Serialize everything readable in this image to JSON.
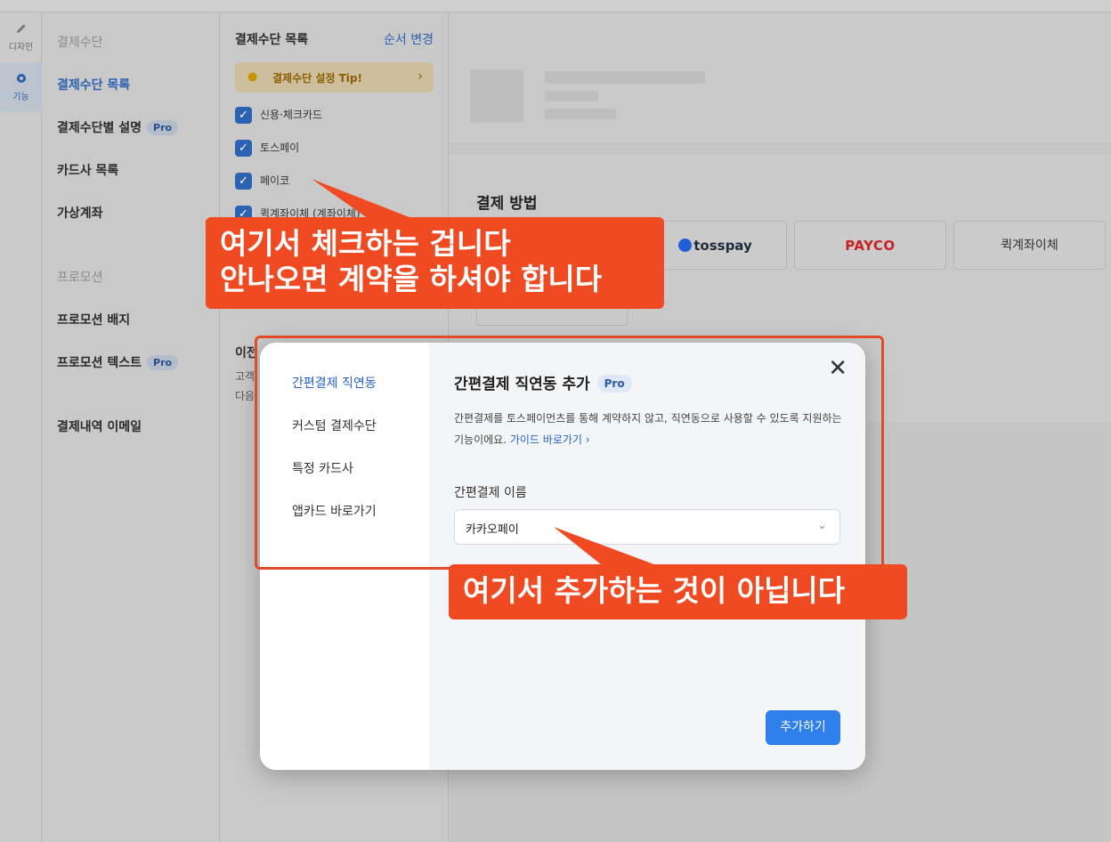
{
  "rail": [
    {
      "label": "디자인",
      "icon": "pencil-icon"
    },
    {
      "label": "기능",
      "icon": "gear-icon"
    }
  ],
  "nav": {
    "section_payment": "결제수단",
    "items_payment": [
      {
        "label": "결제수단 목록"
      },
      {
        "label": "결제수단별 설명",
        "badge": "Pro"
      },
      {
        "label": "카드사 목록"
      },
      {
        "label": "가상계좌"
      }
    ],
    "section_promo": "프로모션",
    "items_promo": [
      {
        "label": "프로모션 배지"
      },
      {
        "label": "프로모션 텍스트",
        "badge": "Pro"
      }
    ],
    "email": "결제내역 이메일"
  },
  "list": {
    "title": "결제수단 목록",
    "order_button": "순서 변경",
    "tip": "결제수단 설정 Tip!",
    "methods": [
      "신용·체크카드",
      "토스페이",
      "페이코",
      "퀵계좌이체 (계좌이체)"
    ],
    "prev_title": "이전",
    "prev_lines": [
      "고객",
      "다음"
    ]
  },
  "preview": {
    "heading": "결제 방법",
    "buttons": [
      "tosspay",
      "PAYCO",
      "퀵계좌이체"
    ]
  },
  "modal": {
    "tabs": [
      "간편결제 직연동",
      "커스텀 결제수단",
      "특정 카드사",
      "앱카드 바로가기"
    ],
    "title": "간편결제 직연동 추가",
    "badge": "Pro",
    "desc": "간편결제를 토스페이먼츠를 통해 계약하지 않고, 직연동으로 사용할 수 있도록 지원하는 기능이에요.",
    "guide_link": "가이드 바로가기",
    "field_label": "간편결제 이름",
    "field_value": "카카오페이",
    "add_button": "추가하기"
  },
  "annotations": {
    "callout1_line1": "여기서 체크하는 겁니다",
    "callout1_line2": "안나오면 계약을 하셔야 합니다",
    "callout2": "여기서 추가하는 것이 아닙니다"
  },
  "colors": {
    "accent": "#2f80ed",
    "annotation": "#f04a23",
    "active_link": "#2563c9"
  }
}
